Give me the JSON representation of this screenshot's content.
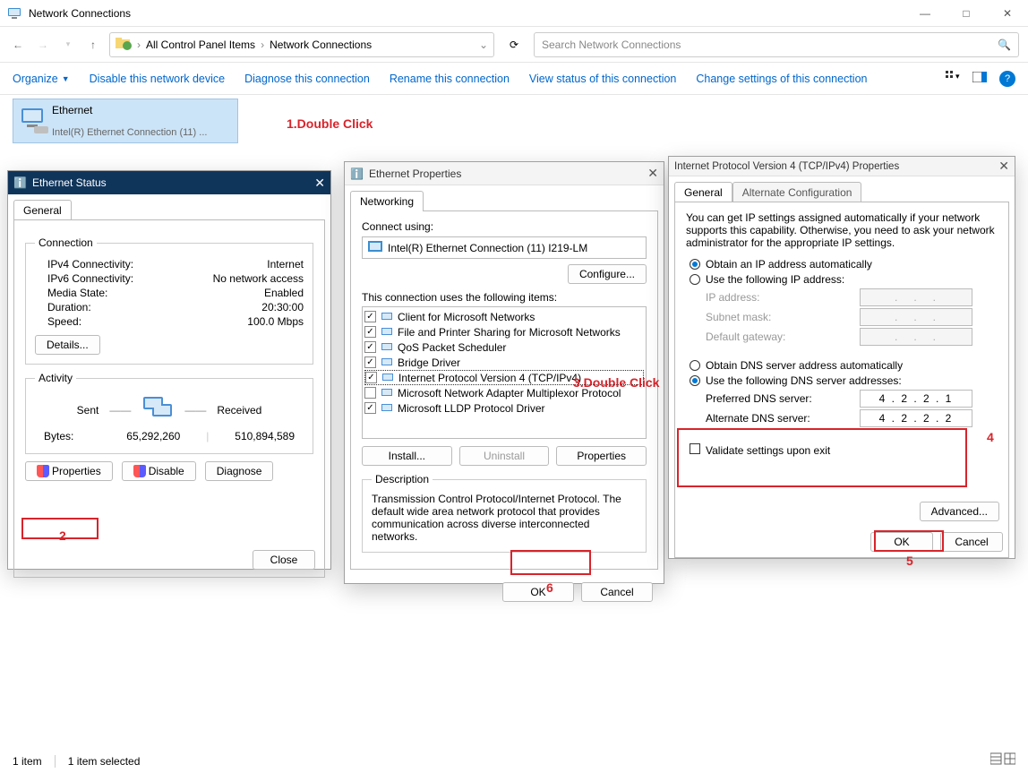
{
  "window": {
    "title": "Network Connections",
    "breadcrumb1": "All Control Panel Items",
    "breadcrumb2": "Network Connections",
    "search_placeholder": "Search Network Connections"
  },
  "commands": {
    "organize": "Organize",
    "disable": "Disable this network device",
    "diagnose": "Diagnose this connection",
    "rename": "Rename this connection",
    "view_status": "View status of this connection",
    "change": "Change settings of this connection"
  },
  "adapter": {
    "name": "Ethernet",
    "desc": "Intel(R) Ethernet Connection (11) ..."
  },
  "annot": {
    "a1": "1.Double Click",
    "a2": "2",
    "a3": "3.Double Click",
    "a4": "4",
    "a5": "5",
    "a6": "6"
  },
  "status_dlg": {
    "title": "Ethernet Status",
    "tab": "General",
    "conn_legend": "Connection",
    "act_legend": "Activity",
    "rows": {
      "ipv4_l": "IPv4 Connectivity:",
      "ipv4_v": "Internet",
      "ipv6_l": "IPv6 Connectivity:",
      "ipv6_v": "No network access",
      "media_l": "Media State:",
      "media_v": "Enabled",
      "dur_l": "Duration:",
      "dur_v": "20:30:00",
      "speed_l": "Speed:",
      "speed_v": "100.0 Mbps"
    },
    "details_btn": "Details...",
    "sent": "Sent",
    "received": "Received",
    "bytes_l": "Bytes:",
    "bytes_sent": "65,292,260",
    "bytes_recv": "510,894,589",
    "btn_props": "Properties",
    "btn_disable": "Disable",
    "btn_diag": "Diagnose",
    "btn_close": "Close"
  },
  "props_dlg": {
    "title": "Ethernet Properties",
    "tab": "Networking",
    "connect_using": "Connect using:",
    "nic": "Intel(R) Ethernet Connection (11) I219-LM",
    "configure": "Configure...",
    "items_label": "This connection uses the following items:",
    "items": [
      {
        "c": true,
        "t": "Client for Microsoft Networks"
      },
      {
        "c": true,
        "t": "File and Printer Sharing for Microsoft Networks"
      },
      {
        "c": true,
        "t": "QoS Packet Scheduler"
      },
      {
        "c": true,
        "t": "Bridge Driver"
      },
      {
        "c": true,
        "t": "Internet Protocol Version 4 (TCP/IPv4)",
        "sel": true
      },
      {
        "c": false,
        "t": "Microsoft Network Adapter Multiplexor Protocol"
      },
      {
        "c": true,
        "t": "Microsoft LLDP Protocol Driver"
      }
    ],
    "install": "Install...",
    "uninstall": "Uninstall",
    "props": "Properties",
    "desc_legend": "Description",
    "desc": "Transmission Control Protocol/Internet Protocol. The default wide area network protocol that provides communication across diverse interconnected networks.",
    "ok": "OK",
    "cancel": "Cancel"
  },
  "tcpip_dlg": {
    "title": "Internet Protocol Version 4 (TCP/IPv4) Properties",
    "tab1": "General",
    "tab2": "Alternate Configuration",
    "intro": "You can get IP settings assigned automatically if your network supports this capability. Otherwise, you need to ask your network administrator for the appropriate IP settings.",
    "r1": "Obtain an IP address automatically",
    "r2": "Use the following IP address:",
    "ip_l": "IP address:",
    "mask_l": "Subnet mask:",
    "gw_l": "Default gateway:",
    "r3": "Obtain DNS server address automatically",
    "r4": "Use the following DNS server addresses:",
    "dns1_l": "Preferred DNS server:",
    "dns1_v": "4  .  2  .  2  .  1",
    "dns2_l": "Alternate DNS server:",
    "dns2_v": "4  .  2  .  2  .  2",
    "validate": "Validate settings upon exit",
    "advanced": "Advanced...",
    "ok": "OK",
    "cancel": "Cancel"
  },
  "footer": {
    "items": "1 item",
    "selected": "1 item selected"
  }
}
